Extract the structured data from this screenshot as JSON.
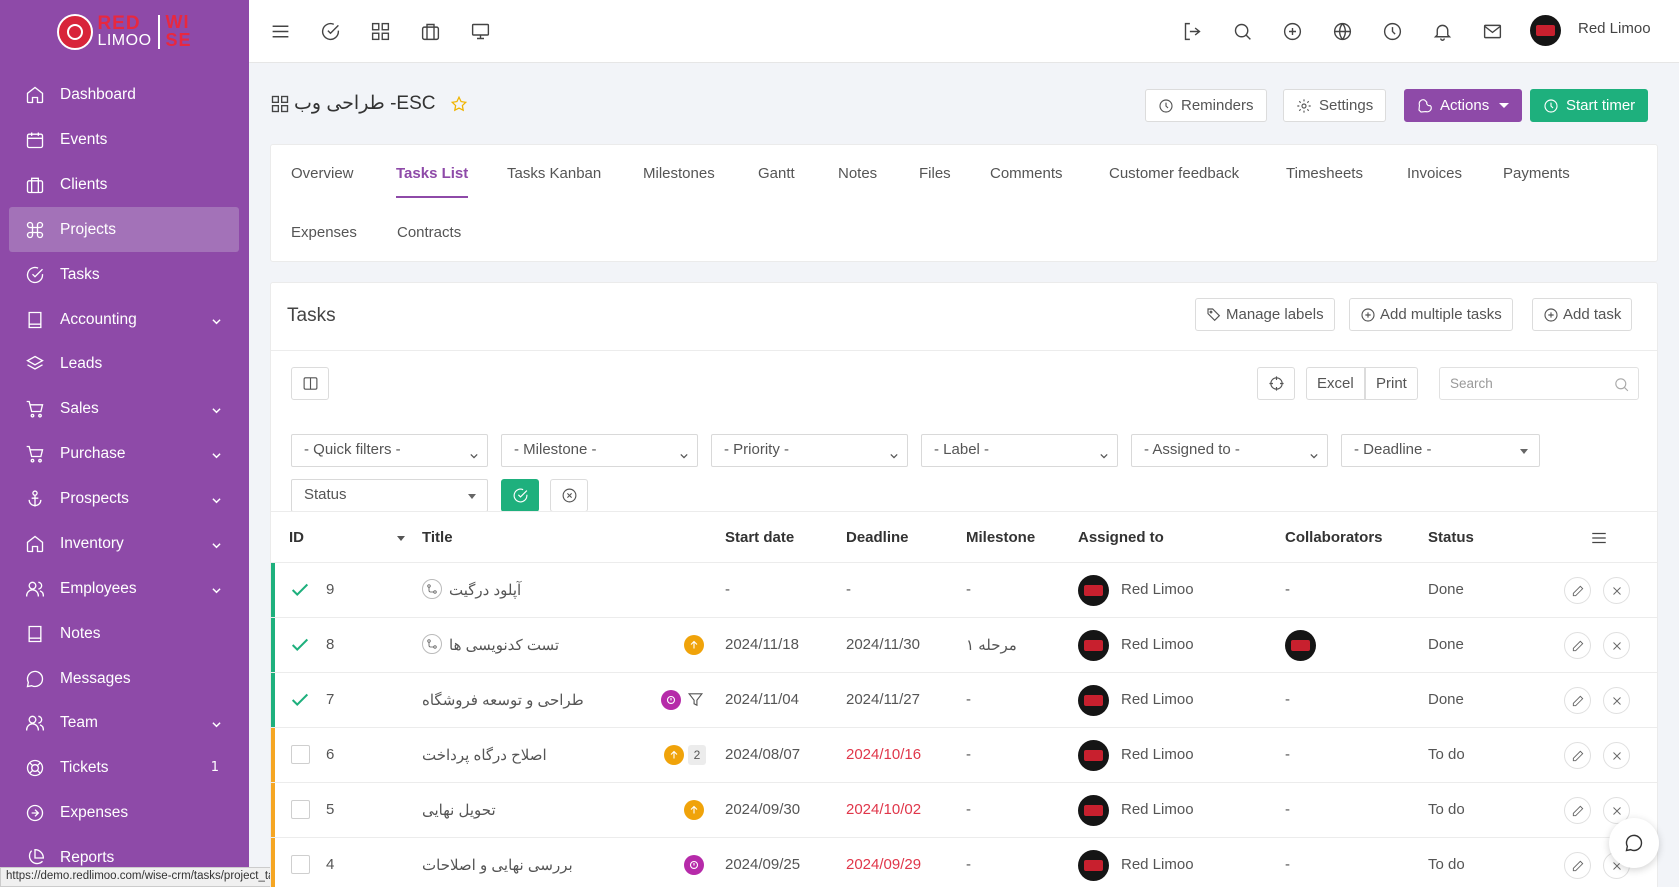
{
  "logo": {
    "line1": "RED",
    "line2": "LIMOO",
    "line3a": "WI",
    "line3b": "SE"
  },
  "sidebar": {
    "items": [
      {
        "label": "Dashboard",
        "icon": "home-icon"
      },
      {
        "label": "Events",
        "icon": "calendar-icon"
      },
      {
        "label": "Clients",
        "icon": "briefcase-icon"
      },
      {
        "label": "Projects",
        "icon": "command-icon"
      },
      {
        "label": "Tasks",
        "icon": "check-circle-icon"
      },
      {
        "label": "Accounting",
        "icon": "book-icon"
      },
      {
        "label": "Leads",
        "icon": "layers-icon"
      },
      {
        "label": "Sales",
        "icon": "cart-icon"
      },
      {
        "label": "Purchase",
        "icon": "cart-icon"
      },
      {
        "label": "Prospects",
        "icon": "anchor-icon"
      },
      {
        "label": "Inventory",
        "icon": "home-icon"
      },
      {
        "label": "Employees",
        "icon": "users-icon"
      },
      {
        "label": "Notes",
        "icon": "book-icon"
      },
      {
        "label": "Messages",
        "icon": "message-icon"
      },
      {
        "label": "Team",
        "icon": "users-icon"
      },
      {
        "label": "Tickets",
        "icon": "life-buoy-icon",
        "badge": "1"
      },
      {
        "label": "Expenses",
        "icon": "arrow-circle-icon"
      },
      {
        "label": "Reports",
        "icon": "pie-icon"
      }
    ]
  },
  "statusbar": {
    "url": "https://demo.redlimoo.com/wise-crm/tasks/project_tasks/1"
  },
  "topbar": {
    "user_name": "Red Limoo"
  },
  "project": {
    "title": "طراحی وب -ESC"
  },
  "header_buttons": {
    "reminders": "Reminders",
    "settings": "Settings",
    "actions": "Actions",
    "start_timer": "Start timer"
  },
  "tabs": [
    "Overview",
    "Tasks List",
    "Tasks Kanban",
    "Milestones",
    "Gantt",
    "Notes",
    "Files",
    "Comments",
    "Customer feedback",
    "Timesheets",
    "Invoices",
    "Payments",
    "Expenses",
    "Contracts"
  ],
  "tasks_card": {
    "title": "Tasks",
    "manage_labels": "Manage labels",
    "add_multiple": "Add multiple tasks",
    "add_task": "Add task",
    "excel": "Excel",
    "print": "Print",
    "search_placeholder": "Search"
  },
  "filters": {
    "quick": "- Quick filters -",
    "milestone": "- Milestone -",
    "priority": "- Priority -",
    "label": "- Label -",
    "assigned": "- Assigned to -",
    "deadline": "- Deadline -",
    "status": "Status"
  },
  "columns": {
    "id": "ID",
    "title": "Title",
    "start": "Start date",
    "deadline": "Deadline",
    "milestone": "Milestone",
    "assigned": "Assigned to",
    "collaborators": "Collaborators",
    "status": "Status"
  },
  "rows": [
    {
      "id": "9",
      "title": "آپلود درگیت",
      "start": "-",
      "deadline": "-",
      "milestone": "-",
      "assigned": "Red Limoo",
      "collaborators": "-",
      "status": "Done",
      "done": true
    },
    {
      "id": "8",
      "title": "تست کدنویسی ها",
      "start": "2024/11/18",
      "deadline": "2024/11/30",
      "milestone": "مرحله ۱",
      "assigned": "Red Limoo",
      "collaborators": "",
      "status": "Done",
      "done": true
    },
    {
      "id": "7",
      "title": "طراحی و توسعه فروشگاه",
      "start": "2024/11/04",
      "deadline": "2024/11/27",
      "milestone": "-",
      "assigned": "Red Limoo",
      "collaborators": "-",
      "status": "Done",
      "done": true
    },
    {
      "id": "6",
      "title": "اصلاح درگاه پرداخت",
      "start": "2024/08/07",
      "deadline": "2024/10/16",
      "milestone": "-",
      "assigned": "Red Limoo",
      "collaborators": "-",
      "status": "To do",
      "done": false,
      "sub_count": "2"
    },
    {
      "id": "5",
      "title": "تحویل نهایی",
      "start": "2024/09/30",
      "deadline": "2024/10/02",
      "milestone": "-",
      "assigned": "Red Limoo",
      "collaborators": "-",
      "status": "To do",
      "done": false
    },
    {
      "id": "4",
      "title": "بررسی نهایی و اصلاحات",
      "start": "2024/09/25",
      "deadline": "2024/09/29",
      "milestone": "-",
      "assigned": "Red Limoo",
      "collaborators": "-",
      "status": "To do",
      "done": false
    }
  ],
  "colors": {
    "sidebar": "#8e4aa8",
    "accent": "#8e4aa8",
    "success": "#1eb07d",
    "warning": "#f5a623",
    "overdue": "#e0364a"
  }
}
